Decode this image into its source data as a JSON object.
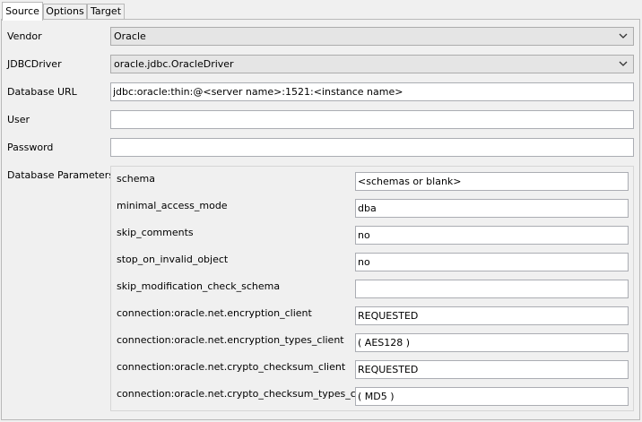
{
  "tabs": [
    {
      "label": "Source",
      "active": true
    },
    {
      "label": "Options",
      "active": false
    },
    {
      "label": "Target",
      "active": false
    }
  ],
  "form": {
    "vendor": {
      "label": "Vendor",
      "value": "Oracle"
    },
    "jdbc_driver": {
      "label": "JDBCDriver",
      "value": "oracle.jdbc.OracleDriver"
    },
    "database_url": {
      "label": "Database URL",
      "value": "jdbc:oracle:thin:@<server name>:1521:<instance name>"
    },
    "user": {
      "label": "User",
      "value": ""
    },
    "password": {
      "label": "Password",
      "value": ""
    },
    "database_parameters_label": "Database Parameters"
  },
  "parameters": [
    {
      "name": "schema",
      "value": "<schemas or blank>"
    },
    {
      "name": "minimal_access_mode",
      "value": "dba"
    },
    {
      "name": "skip_comments",
      "value": "no"
    },
    {
      "name": "stop_on_invalid_object",
      "value": "no"
    },
    {
      "name": "skip_modification_check_schema",
      "value": ""
    },
    {
      "name": "connection:oracle.net.encryption_client",
      "value": "REQUESTED"
    },
    {
      "name": "connection:oracle.net.encryption_types_client",
      "value": "( AES128 )"
    },
    {
      "name": "connection:oracle.net.crypto_checksum_client",
      "value": "REQUESTED"
    },
    {
      "name": "connection:oracle.net.crypto_checksum_types_client",
      "value": "( MD5 )"
    }
  ],
  "icons": {
    "dropdown": "chevron-down-icon"
  },
  "colors": {
    "panel_bg": "#f0f0f0",
    "combo_bg": "#e5e5e5",
    "input_border": "#abadb3"
  }
}
